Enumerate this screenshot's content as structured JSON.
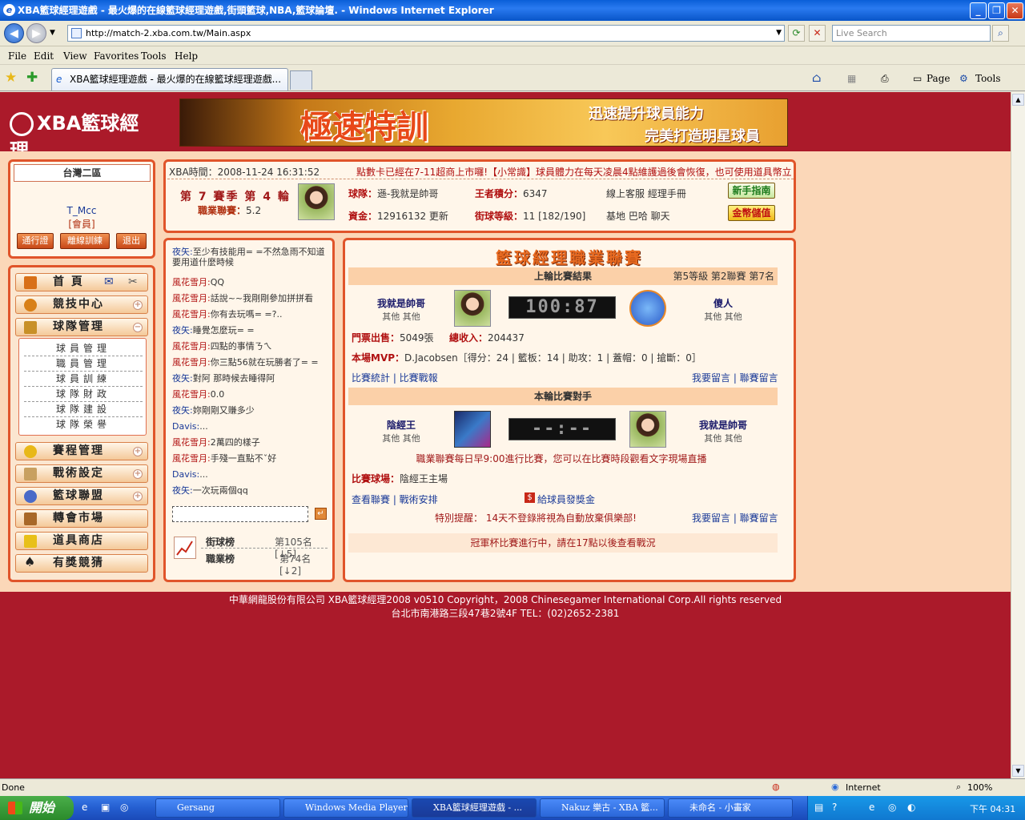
{
  "window": {
    "title": "XBA籃球經理遊戲 - 最火爆的在線籃球經理遊戲,街頭籃球,NBA,籃球論壇. - Windows Internet Explorer"
  },
  "address": {
    "url": "http://match-2.xba.com.tw/Main.aspx",
    "search_placeholder": "Live Search"
  },
  "menu": [
    "File",
    "Edit",
    "View",
    "Favorites",
    "Tools",
    "Help"
  ],
  "tab": {
    "title": "XBA籃球經理遊戲 - 最火爆的在線籃球經理遊戲..."
  },
  "toolbar": {
    "page": "Page",
    "tools": "Tools"
  },
  "banner": {
    "main": "極速特訓",
    "line1": "迅速提升球員能力",
    "line2": "完美打造明星球員",
    "logo": "XBA籃球經理"
  },
  "user": {
    "server": "台灣二區",
    "name": "T_Mcc",
    "role": "[會員]",
    "buttons": [
      "通行證",
      "離線訓練",
      "退出"
    ]
  },
  "nav": {
    "home": "首 頁",
    "items": [
      "競技中心",
      "球隊管理",
      "賽程管理",
      "戰術設定",
      "籃球聯盟",
      "轉會市場",
      "道具商店",
      "有獎競猜"
    ],
    "team_sub": [
      "球員管理",
      "職員管理",
      "球員訓練",
      "球隊財政",
      "球隊建設",
      "球隊榮譽"
    ]
  },
  "info": {
    "time_label": "XBA時間：",
    "time": "2008-11-24 16:31:52",
    "marquee": "點數卡已經在7-11超商上市囉!【小常識】球員體力在每天凌晨4點維護過後會恢復，也可使用道具幣立",
    "season": "第 7 賽季 第 4 輪",
    "career_label": "職業聯賽：",
    "career": "5.2",
    "team_label": "球隊：",
    "team": "遜-我就是帥哥",
    "king_label": "王者積分：",
    "king": "6347",
    "service": "線上客服  經理手冊",
    "funds_label": "資金：",
    "funds": "12916132",
    "refresh": "更新",
    "level_label": "街球等級：",
    "level": "11 [182/190]",
    "links": "基地  巴哈  聊天",
    "guide": "新手指南",
    "deposit": "金幣儲值"
  },
  "chat": {
    "lines": [
      {
        "who": "夜矢:",
        "msg": "至少有技能用= =不然急雨不知道要用道什麼時候"
      },
      {
        "who": "風花雪月:",
        "msg": "QQ"
      },
      {
        "who": "風花雪月:",
        "msg": "話說~~我剛剛參加拼拼看"
      },
      {
        "who": "風花雪月:",
        "msg": "你有去玩嗎= =?.."
      },
      {
        "who": "夜矢:",
        "msg": "睡覺怎麼玩= ="
      },
      {
        "who": "風花雪月:",
        "msg": "四點的事情ㄋㄟ"
      },
      {
        "who": "風花雪月:",
        "msg": "你三點56就在玩勝者了= ="
      },
      {
        "who": "夜矢:",
        "msg": "對阿 那時候去睡得阿"
      },
      {
        "who": "風花雪月:",
        "msg": "0.0"
      },
      {
        "who": "夜矢:",
        "msg": "妳剛剛又賺多少"
      },
      {
        "who": "Davis:",
        "msg": "..."
      },
      {
        "who": "風花雪月:",
        "msg": "2萬四的樣子"
      },
      {
        "who": "風花雪月:",
        "msg": "手殘一直點不ˇ好"
      },
      {
        "who": "Davis:",
        "msg": "..."
      },
      {
        "who": "夜矢:",
        "msg": "一次玩兩個qq"
      }
    ],
    "street_rank": "街球榜",
    "street_pos": "第105名[↓5]",
    "pro_rank": "職業榜",
    "pro_pos": "第74名[↓2]"
  },
  "league": {
    "title": "籃球經理職業聯賽",
    "last_result": "上輪比賽結果",
    "last_meta": "第5等級  第2聯賽  第7名",
    "home": "我就是帥哥",
    "home_sub": "其他  其他",
    "away": "傻人",
    "away_sub": "其他  其他",
    "score": "100:87",
    "tickets_label": "門票出售：",
    "tickets": "5049張",
    "income_label": "總收入：",
    "income": "204437",
    "mvp_label": "本場MVP：",
    "mvp": "D.Jacobsen［得分：24 | 籃板：14 | 助攻：1 | 蓋帽：0 | 搶斷：0］",
    "stats_links": "比賽統計 | 比賽戰報",
    "comment_links": "我要留言 | 聯賽留言",
    "next_title": "本輪比賽對手",
    "opp": "陰經王",
    "opp_sub": "其他  其他",
    "me": "我就是帥哥",
    "me_sub": "其他  其他",
    "next_score": "--:--",
    "notice": "職業聯賽每日早9:00進行比賽，您可以在比賽時段觀看文字現場直播",
    "venue_label": "比賽球場：",
    "venue": "陰經王主場",
    "league_links": "查看聯賽 | 戰術安排",
    "bonus": "給球員發獎金",
    "remind": "特別提醒： 14天不登錄將視為自動放棄俱樂部!",
    "comment_links2": "我要留言 | 聯賽留言",
    "cup": "冠軍杯比賽進行中，請在17點以後查看戰況"
  },
  "footer": {
    "line1": "中華網龍股份有限公司  XBA籃球經理2008 v0510    Copyright，2008 Chinesegamer International Corp.All rights reserved",
    "line2": "台北市南港路三段47巷2號4F TEL：(02)2652-2381"
  },
  "status": {
    "left": "Done",
    "zone": "Internet",
    "zoom": "100%"
  },
  "taskbar": {
    "start": "開始",
    "tasks": [
      "Gersang",
      "Windows Media Player",
      "XBA籃球經理遊戲 - ...",
      "Nakuz 樂古 - XBA 籃...",
      "未命名 - 小畫家"
    ],
    "clock": "下午 04:31"
  },
  "colors": {
    "page_bg": "#ab1a2a",
    "panel_border": "#e0542a",
    "content_bg": "#fbd7b8"
  }
}
